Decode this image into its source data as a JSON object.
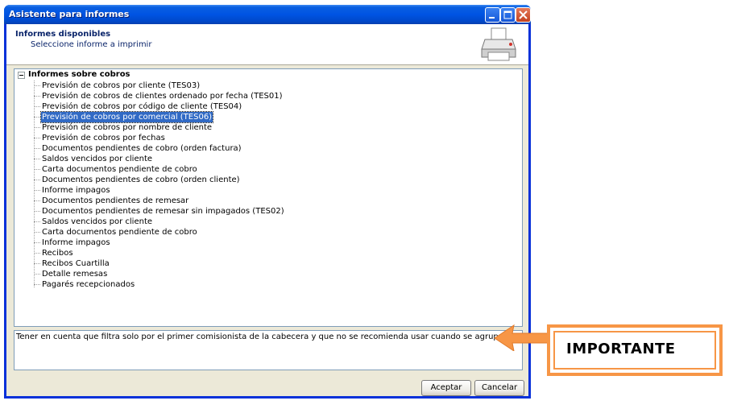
{
  "window": {
    "title": "Asistente para informes"
  },
  "header": {
    "title": "Informes disponibles",
    "subtitle": "Seleccione informe a imprimir",
    "icon": "printer-icon"
  },
  "tree": {
    "root_label": "Informes sobre cobros",
    "selected_index": 3,
    "items": [
      "Previsión de cobros por cliente (TES03)",
      "Previsión de cobros de clientes ordenado por fecha (TES01)",
      "Previsión de cobros por código de cliente (TES04)",
      "Previsión de cobros por comercial (TES06)",
      "Previsión de cobros por nombre de cliente",
      "Previsión de cobros por fechas",
      "Documentos pendientes de cobro (orden factura)",
      "Saldos vencidos por cliente",
      "Carta documentos pendiente de cobro",
      "Documentos pendientes de cobro (orden cliente)",
      "Informe impagos",
      "Documentos pendientes de remesar",
      "Documentos pendientes de remesar sin impagados (TES02)",
      "Saldos vencidos por cliente",
      "Carta documentos pendiente de cobro",
      "Informe impagos",
      "Recibos",
      "Recibos Cuartilla",
      "Detalle remesas",
      "Pagarés recepcionados"
    ]
  },
  "note": {
    "text": "Tener en cuenta que filtra solo por el primer comisionista de la cabecera y que no se recomienda usar cuando se agrupan efectos de distintas facturas."
  },
  "buttons": {
    "accept": "Aceptar",
    "cancel": "Cancelar"
  },
  "annotation": {
    "label": "IMPORTANTE",
    "color": "#f79646"
  }
}
